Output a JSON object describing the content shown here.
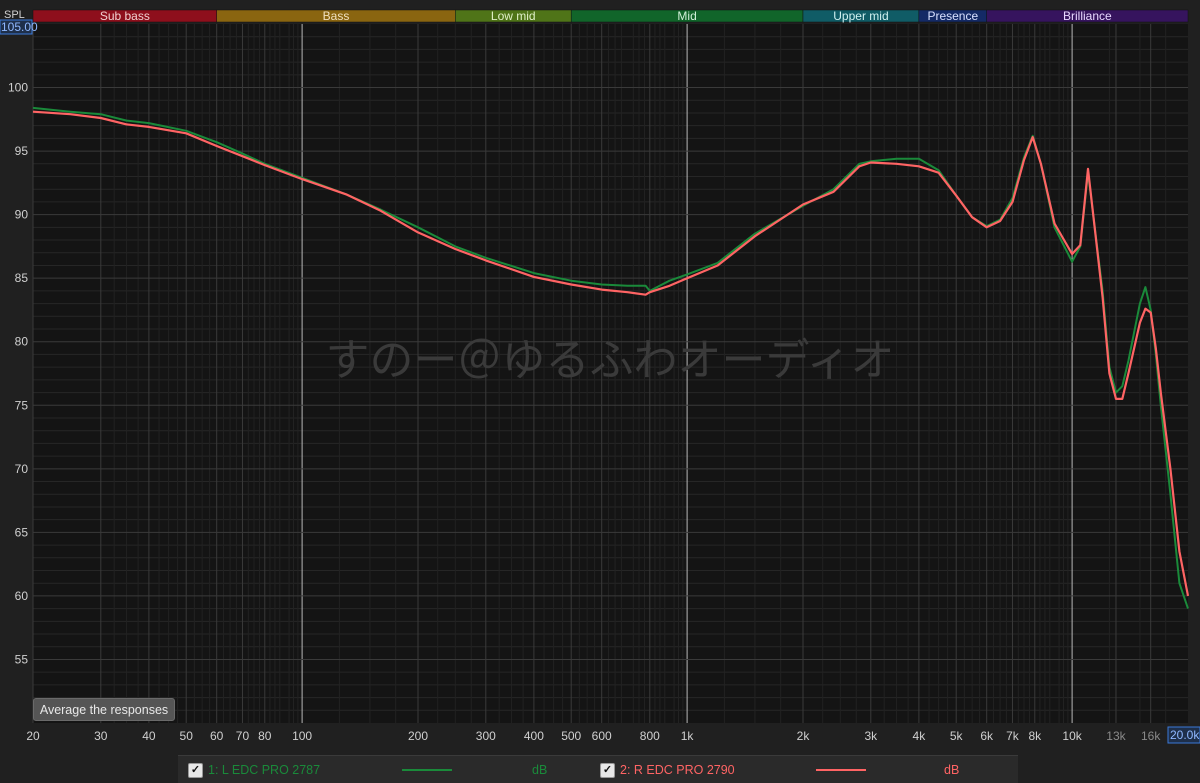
{
  "app": {
    "y_axis_name": "SPL",
    "y_max_box": "105.00",
    "x_max_box": "20.0k",
    "watermark": "すのー＠ゆるふわオーディオ",
    "average_button": "Average the responses"
  },
  "bands": [
    {
      "label": "Sub bass",
      "from": 20,
      "to": 60,
      "color": "#8e0f1c",
      "text": "#f0d0d0"
    },
    {
      "label": "Bass",
      "from": 60,
      "to": 250,
      "color": "#8a6510",
      "text": "#f0e0c0"
    },
    {
      "label": "Low mid",
      "from": 250,
      "to": 500,
      "color": "#4f7418",
      "text": "#e0f0c8"
    },
    {
      "label": "Mid",
      "from": 500,
      "to": 2000,
      "color": "#11652a",
      "text": "#d0f0d8"
    },
    {
      "label": "Upper mid",
      "from": 2000,
      "to": 4000,
      "color": "#105c66",
      "text": "#d0f0f0"
    },
    {
      "label": "Presence",
      "from": 4000,
      "to": 6000,
      "color": "#142a66",
      "text": "#d8e0ff"
    },
    {
      "label": "Brilliance",
      "from": 6000,
      "to": 20000,
      "color": "#36145e",
      "text": "#e8d8ff"
    }
  ],
  "legend": [
    {
      "checked": "✓",
      "name": "1: L EDC PRO 2787",
      "unit": "dB",
      "color": "#1a8a3a"
    },
    {
      "checked": "✓",
      "name": "2: R EDC PRO 2790",
      "unit": "dB",
      "color": "#ff6464"
    }
  ],
  "chart_data": {
    "type": "line",
    "xscale": "log",
    "xlim": [
      20,
      20000
    ],
    "ylim": [
      50,
      105
    ],
    "x_ticks": [
      {
        "v": 20,
        "label": "20"
      },
      {
        "v": 30,
        "label": "30"
      },
      {
        "v": 40,
        "label": "40"
      },
      {
        "v": 50,
        "label": "50"
      },
      {
        "v": 60,
        "label": "60"
      },
      {
        "v": 70,
        "label": "70"
      },
      {
        "v": 80,
        "label": "80"
      },
      {
        "v": 100,
        "label": "100"
      },
      {
        "v": 200,
        "label": "200"
      },
      {
        "v": 300,
        "label": "300"
      },
      {
        "v": 400,
        "label": "400"
      },
      {
        "v": 500,
        "label": "500"
      },
      {
        "v": 600,
        "label": "600"
      },
      {
        "v": 800,
        "label": "800"
      },
      {
        "v": 1000,
        "label": "1k"
      },
      {
        "v": 2000,
        "label": "2k"
      },
      {
        "v": 3000,
        "label": "3k"
      },
      {
        "v": 4000,
        "label": "4k"
      },
      {
        "v": 5000,
        "label": "5k"
      },
      {
        "v": 6000,
        "label": "6k"
      },
      {
        "v": 7000,
        "label": "7k"
      },
      {
        "v": 8000,
        "label": "8k"
      },
      {
        "v": 10000,
        "label": "10k"
      },
      {
        "v": 13000,
        "label": "13k"
      },
      {
        "v": 16000,
        "label": "16k"
      }
    ],
    "y_ticks": [
      55,
      60,
      65,
      70,
      75,
      80,
      85,
      90,
      95,
      100
    ],
    "series": [
      {
        "name": "1: L EDC PRO 2787",
        "color": "#1a8a3a",
        "x": [
          20,
          25,
          30,
          35,
          40,
          50,
          60,
          70,
          80,
          100,
          130,
          160,
          200,
          250,
          300,
          400,
          500,
          600,
          700,
          780,
          800,
          900,
          1000,
          1200,
          1500,
          2000,
          2400,
          2800,
          3000,
          3500,
          4000,
          4500,
          5000,
          5500,
          6000,
          6500,
          7000,
          7500,
          7900,
          8300,
          9000,
          10000,
          10500,
          11000,
          12000,
          12500,
          13000,
          13500,
          14000,
          15000,
          15500,
          16000,
          16500,
          17000,
          18000,
          19000,
          20000
        ],
        "y": [
          98.4,
          98.1,
          97.9,
          97.4,
          97.2,
          96.6,
          95.7,
          94.8,
          94.0,
          92.9,
          91.6,
          90.4,
          89.0,
          87.5,
          86.6,
          85.4,
          84.8,
          84.5,
          84.4,
          84.4,
          84.0,
          84.8,
          85.3,
          86.2,
          88.5,
          90.7,
          92.0,
          94.0,
          94.2,
          94.4,
          94.4,
          93.5,
          91.5,
          89.8,
          89.1,
          89.6,
          91.3,
          94.5,
          96.2,
          94.0,
          89.0,
          86.3,
          87.5,
          93.3,
          84.0,
          78.0,
          76.0,
          76.5,
          78.5,
          83.0,
          84.3,
          82.5,
          79.0,
          75.0,
          68.0,
          61.0,
          59.0
        ]
      },
      {
        "name": "2: R EDC PRO 2790",
        "color": "#ff6464",
        "x": [
          20,
          25,
          30,
          35,
          40,
          50,
          60,
          70,
          80,
          100,
          130,
          160,
          200,
          250,
          300,
          400,
          500,
          600,
          700,
          780,
          800,
          900,
          1000,
          1200,
          1500,
          2000,
          2400,
          2800,
          3000,
          3500,
          4000,
          4500,
          5000,
          5500,
          6000,
          6500,
          7000,
          7500,
          7900,
          8300,
          9000,
          10000,
          10500,
          11000,
          12000,
          12500,
          13000,
          13500,
          14000,
          15000,
          15500,
          16000,
          16500,
          17000,
          18000,
          19000,
          20000
        ],
        "y": [
          98.1,
          97.9,
          97.6,
          97.1,
          96.9,
          96.4,
          95.4,
          94.6,
          93.9,
          92.8,
          91.6,
          90.3,
          88.6,
          87.3,
          86.4,
          85.1,
          84.5,
          84.1,
          83.9,
          83.7,
          83.9,
          84.4,
          85.0,
          86.0,
          88.3,
          90.8,
          91.8,
          93.8,
          94.1,
          94.0,
          93.8,
          93.3,
          91.5,
          89.8,
          89.0,
          89.5,
          91.0,
          94.3,
          96.1,
          94.0,
          89.3,
          86.9,
          87.6,
          93.6,
          83.5,
          77.5,
          75.5,
          75.5,
          77.5,
          81.5,
          82.6,
          82.3,
          79.5,
          76.0,
          70.0,
          63.5,
          60.0
        ]
      }
    ]
  }
}
